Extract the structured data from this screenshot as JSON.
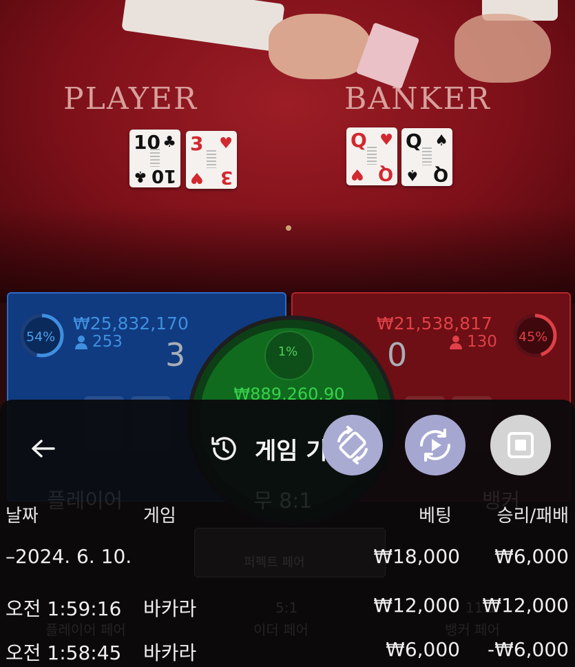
{
  "video": {
    "player_label": "PLAYER",
    "banker_label": "BANKER",
    "player_cards": [
      {
        "rank": "10",
        "suit": "♣",
        "color": "black"
      },
      {
        "rank": "3",
        "suit": "♥",
        "color": "red"
      }
    ],
    "banker_cards": [
      {
        "rank": "Q",
        "suit": "♥",
        "color": "red"
      },
      {
        "rank": "Q",
        "suit": "♠",
        "color": "black"
      }
    ]
  },
  "player": {
    "percent": "54%",
    "amount": "₩25,832,170",
    "players": "253",
    "score": "3",
    "color": "#3f8fe0"
  },
  "banker": {
    "percent": "45%",
    "amount": "₩21,538,817",
    "players": "130",
    "score": "0",
    "color": "#e04048"
  },
  "tie": {
    "percent": "1%",
    "amount": "₩889,260.90"
  },
  "background_labels": {
    "player": "플레이어",
    "tie": "무 8:1",
    "banker": "뱅커",
    "player_pair": "플레이어 페어",
    "either_pair": "이더 페어",
    "banker_pair": "뱅커 페어",
    "perfect_pair": "퍼펙트 페어",
    "pair_odds": "11:1",
    "either_odds": "5:1"
  },
  "history": {
    "title": "게임 기록",
    "columns": {
      "date": "날짜",
      "game": "게임",
      "bet": "베팅",
      "result": "승리/패배"
    },
    "day_summary": {
      "date": "–2024. 6. 10.",
      "bet": "₩18,000",
      "result": "₩6,000"
    },
    "rows": [
      {
        "time": "오전 1:59:16",
        "game": "바카라",
        "bet": "₩12,000",
        "result": "₩12,000"
      },
      {
        "time": "오전 1:58:45",
        "game": "바카라",
        "bet": "₩6,000",
        "result": "-₩6,000"
      }
    ]
  },
  "icons": {
    "back": "arrow-left-icon",
    "history": "history-clock-icon",
    "fab1": "rotate-screen-icon",
    "fab2": "replay-icon",
    "fab3": "stop-icon"
  }
}
